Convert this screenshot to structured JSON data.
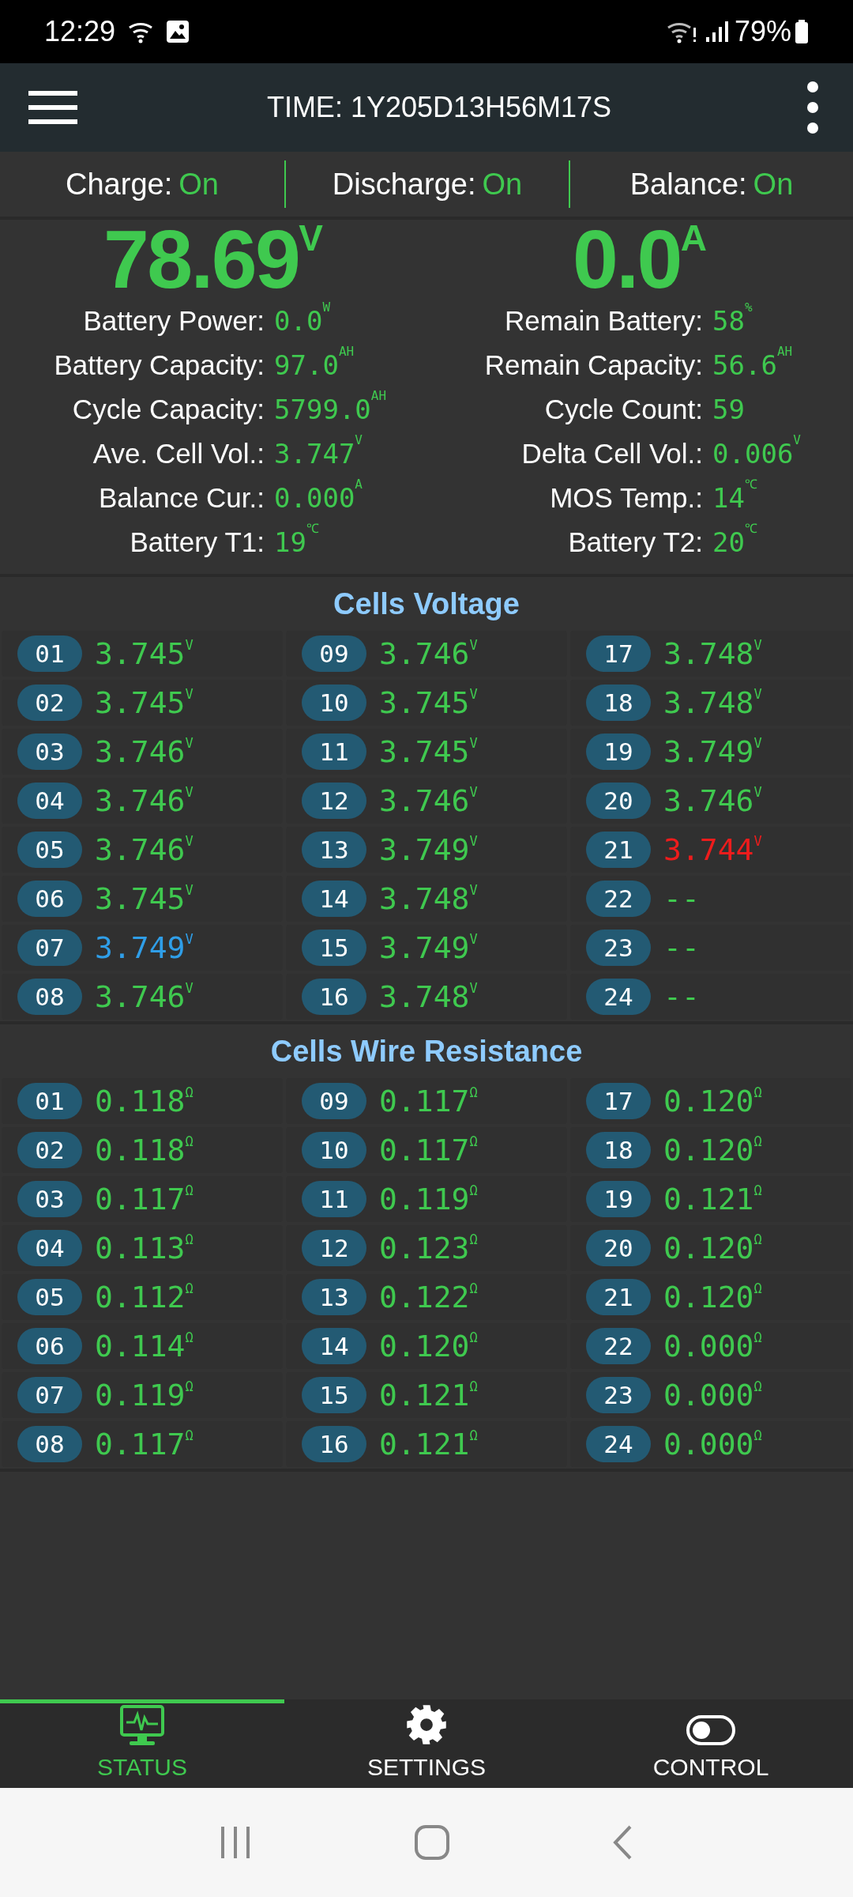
{
  "status_bar": {
    "time": "12:29",
    "battery": "79%"
  },
  "header": {
    "title": "TIME: 1Y205D13H56M17S"
  },
  "flags": [
    {
      "label": "Charge:",
      "value": "On"
    },
    {
      "label": "Discharge:",
      "value": "On"
    },
    {
      "label": "Balance:",
      "value": "On"
    }
  ],
  "main_readings": [
    {
      "value": "78.69",
      "unit": "V"
    },
    {
      "value": "0.0",
      "unit": "A"
    }
  ],
  "stats": [
    {
      "label": "Battery Power:",
      "value": "0.0",
      "unit": "W"
    },
    {
      "label": "Remain Battery:",
      "value": "58",
      "unit": "%"
    },
    {
      "label": "Battery Capacity:",
      "value": "97.0",
      "unit": "AH"
    },
    {
      "label": "Remain Capacity:",
      "value": "56.6",
      "unit": "AH"
    },
    {
      "label": "Cycle Capacity:",
      "value": "5799.0",
      "unit": "AH"
    },
    {
      "label": "Cycle Count:",
      "value": "59"
    },
    {
      "label": "Ave. Cell Vol.:",
      "value": "3.747",
      "unit": "V"
    },
    {
      "label": "Delta Cell Vol.:",
      "value": "0.006",
      "unit": "V"
    },
    {
      "label": "Balance Cur.:",
      "value": "0.000",
      "unit": "A"
    },
    {
      "label": "MOS Temp.:",
      "value": "14",
      "unit": "℃"
    },
    {
      "label": "Battery T1:",
      "value": "19",
      "unit": "℃"
    },
    {
      "label": "Battery T2:",
      "value": "20",
      "unit": "℃"
    }
  ],
  "sections": [
    {
      "title": "Cells Voltage",
      "cells": [
        {
          "index": "01",
          "value": "3.745",
          "unit": "V",
          "color": "#3fc94f"
        },
        {
          "index": "02",
          "value": "3.745",
          "unit": "V",
          "color": "#3fc94f"
        },
        {
          "index": "03",
          "value": "3.746",
          "unit": "V",
          "color": "#3fc94f"
        },
        {
          "index": "04",
          "value": "3.746",
          "unit": "V",
          "color": "#3fc94f"
        },
        {
          "index": "05",
          "value": "3.746",
          "unit": "V",
          "color": "#3fc94f"
        },
        {
          "index": "06",
          "value": "3.745",
          "unit": "V",
          "color": "#3fc94f"
        },
        {
          "index": "07",
          "value": "3.749",
          "unit": "V",
          "color": "#2f9ee8"
        },
        {
          "index": "08",
          "value": "3.746",
          "unit": "V",
          "color": "#3fc94f"
        },
        {
          "index": "09",
          "value": "3.746",
          "unit": "V",
          "color": "#3fc94f"
        },
        {
          "index": "10",
          "value": "3.745",
          "unit": "V",
          "color": "#3fc94f"
        },
        {
          "index": "11",
          "value": "3.745",
          "unit": "V",
          "color": "#3fc94f"
        },
        {
          "index": "12",
          "value": "3.746",
          "unit": "V",
          "color": "#3fc94f"
        },
        {
          "index": "13",
          "value": "3.749",
          "unit": "V",
          "color": "#3fc94f"
        },
        {
          "index": "14",
          "value": "3.748",
          "unit": "V",
          "color": "#3fc94f"
        },
        {
          "index": "15",
          "value": "3.749",
          "unit": "V",
          "color": "#3fc94f"
        },
        {
          "index": "16",
          "value": "3.748",
          "unit": "V",
          "color": "#3fc94f"
        },
        {
          "index": "17",
          "value": "3.748",
          "unit": "V",
          "color": "#3fc94f"
        },
        {
          "index": "18",
          "value": "3.748",
          "unit": "V",
          "color": "#3fc94f"
        },
        {
          "index": "19",
          "value": "3.749",
          "unit": "V",
          "color": "#3fc94f"
        },
        {
          "index": "20",
          "value": "3.746",
          "unit": "V",
          "color": "#3fc94f"
        },
        {
          "index": "21",
          "value": "3.744",
          "unit": "V",
          "color": "#ee1c1c"
        },
        {
          "index": "22",
          "value": "--",
          "color": "#3fc94f"
        },
        {
          "index": "23",
          "value": "--",
          "color": "#3fc94f"
        },
        {
          "index": "24",
          "value": "--",
          "color": "#3fc94f"
        }
      ]
    },
    {
      "title": "Cells Wire Resistance",
      "cells": [
        {
          "index": "01",
          "value": "0.118",
          "unit": "Ω",
          "color": "#3fc94f"
        },
        {
          "index": "02",
          "value": "0.118",
          "unit": "Ω",
          "color": "#3fc94f"
        },
        {
          "index": "03",
          "value": "0.117",
          "unit": "Ω",
          "color": "#3fc94f"
        },
        {
          "index": "04",
          "value": "0.113",
          "unit": "Ω",
          "color": "#3fc94f"
        },
        {
          "index": "05",
          "value": "0.112",
          "unit": "Ω",
          "color": "#3fc94f"
        },
        {
          "index": "06",
          "value": "0.114",
          "unit": "Ω",
          "color": "#3fc94f"
        },
        {
          "index": "07",
          "value": "0.119",
          "unit": "Ω",
          "color": "#3fc94f"
        },
        {
          "index": "08",
          "value": "0.117",
          "unit": "Ω",
          "color": "#3fc94f"
        },
        {
          "index": "09",
          "value": "0.117",
          "unit": "Ω",
          "color": "#3fc94f"
        },
        {
          "index": "10",
          "value": "0.117",
          "unit": "Ω",
          "color": "#3fc94f"
        },
        {
          "index": "11",
          "value": "0.119",
          "unit": "Ω",
          "color": "#3fc94f"
        },
        {
          "index": "12",
          "value": "0.123",
          "unit": "Ω",
          "color": "#3fc94f"
        },
        {
          "index": "13",
          "value": "0.122",
          "unit": "Ω",
          "color": "#3fc94f"
        },
        {
          "index": "14",
          "value": "0.120",
          "unit": "Ω",
          "color": "#3fc94f"
        },
        {
          "index": "15",
          "value": "0.121",
          "unit": "Ω",
          "color": "#3fc94f"
        },
        {
          "index": "16",
          "value": "0.121",
          "unit": "Ω",
          "color": "#3fc94f"
        },
        {
          "index": "17",
          "value": "0.120",
          "unit": "Ω",
          "color": "#3fc94f"
        },
        {
          "index": "18",
          "value": "0.120",
          "unit": "Ω",
          "color": "#3fc94f"
        },
        {
          "index": "19",
          "value": "0.121",
          "unit": "Ω",
          "color": "#3fc94f"
        },
        {
          "index": "20",
          "value": "0.120",
          "unit": "Ω",
          "color": "#3fc94f"
        },
        {
          "index": "21",
          "value": "0.120",
          "unit": "Ω",
          "color": "#3fc94f"
        },
        {
          "index": "22",
          "value": "0.000",
          "unit": "Ω",
          "color": "#3fc94f"
        },
        {
          "index": "23",
          "value": "0.000",
          "unit": "Ω",
          "color": "#3fc94f"
        },
        {
          "index": "24",
          "value": "0.000",
          "unit": "Ω",
          "color": "#3fc94f"
        }
      ]
    }
  ],
  "tabs": [
    {
      "label": "STATUS",
      "kind": "monitor",
      "selected": true
    },
    {
      "label": "SETTINGS",
      "kind": "gear",
      "selected": false
    },
    {
      "label": "CONTROL",
      "kind": "toggle",
      "selected": false
    }
  ]
}
